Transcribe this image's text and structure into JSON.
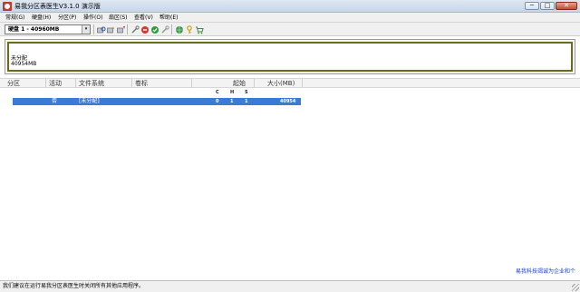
{
  "window": {
    "title": "易我分区表医生V3.1.0 演示版",
    "min_glyph": "─",
    "max_glyph": "□",
    "close_glyph": "✕"
  },
  "menu": [
    {
      "label": "常规(G)"
    },
    {
      "label": "硬盘(H)"
    },
    {
      "label": "分区(P)"
    },
    {
      "label": "操作(O)"
    },
    {
      "label": "扇区(S)"
    },
    {
      "label": "查看(V)"
    },
    {
      "label": "帮助(E)"
    }
  ],
  "toolbar": {
    "disk_select_value": "硬盘 1 - 40960MB",
    "arrow_glyph": "▾",
    "icons": [
      "disk-search-icon",
      "disk-add-icon",
      "disk-remove-icon",
      "tool-icon",
      "stop-icon",
      "apply-check-icon",
      "undo-icon",
      "globe-icon",
      "key-icon",
      "cart-icon"
    ]
  },
  "diskmap": {
    "segment_label": "未分配",
    "segment_size": "40954MB"
  },
  "partition_list": {
    "headers": {
      "partition": "分区",
      "active": "活动",
      "filesystem": "文件系统",
      "volume_label": "卷标",
      "start": "起始",
      "size": "大小(MB)"
    },
    "subheaders": {
      "c": "C",
      "h": "H",
      "s": "S"
    },
    "rows": [
      {
        "partition": "",
        "active": "否",
        "filesystem": "[未分配]",
        "volume_label": "",
        "c": "0",
        "h": "1",
        "s": "1",
        "size": "40954"
      }
    ]
  },
  "footer": {
    "link": "易我科技竭诚为企业和个",
    "status": "我们建议在运行易我分区表医生时关闭所有其他应用程序。"
  },
  "colors": {
    "selection": "#3a7bd5",
    "diskmap_border": "#6b6b1f",
    "link": "#1a3fc8"
  }
}
